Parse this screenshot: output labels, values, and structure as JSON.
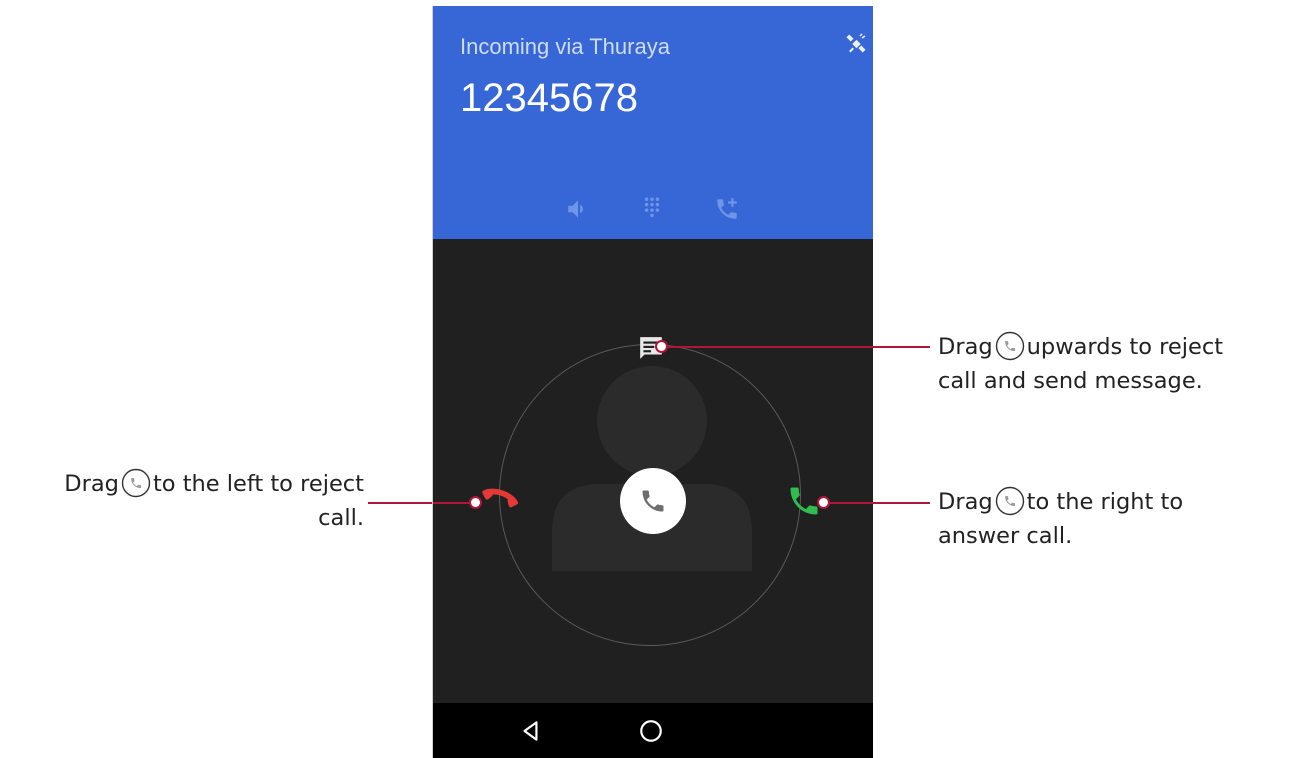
{
  "call_screen": {
    "incoming_text": "Incoming via Thuraya",
    "number": "12345678",
    "header_color": "#3767d6",
    "icons": [
      "satellite-icon",
      "speaker-icon",
      "dialpad-icon",
      "add-call-icon"
    ]
  },
  "controls": {
    "center_icon": "phone-icon",
    "message_icon": "message-icon",
    "reject_icon": "hang-up-icon",
    "accept_icon": "answer-icon",
    "reject_color": "#e53935",
    "accept_color": "#2ebd4e"
  },
  "navbar": {
    "icons": [
      "back-icon",
      "home-icon"
    ]
  },
  "callouts": {
    "message": {
      "prefix": "Drag",
      "line1_rest": "upwards to reject",
      "line2": "call and send message."
    },
    "answer": {
      "prefix": "Drag",
      "line1_rest": "to the right to",
      "line2": "answer call."
    },
    "reject": {
      "prefix": "Drag",
      "line1_rest": "to the left to reject",
      "line2": "call."
    }
  }
}
